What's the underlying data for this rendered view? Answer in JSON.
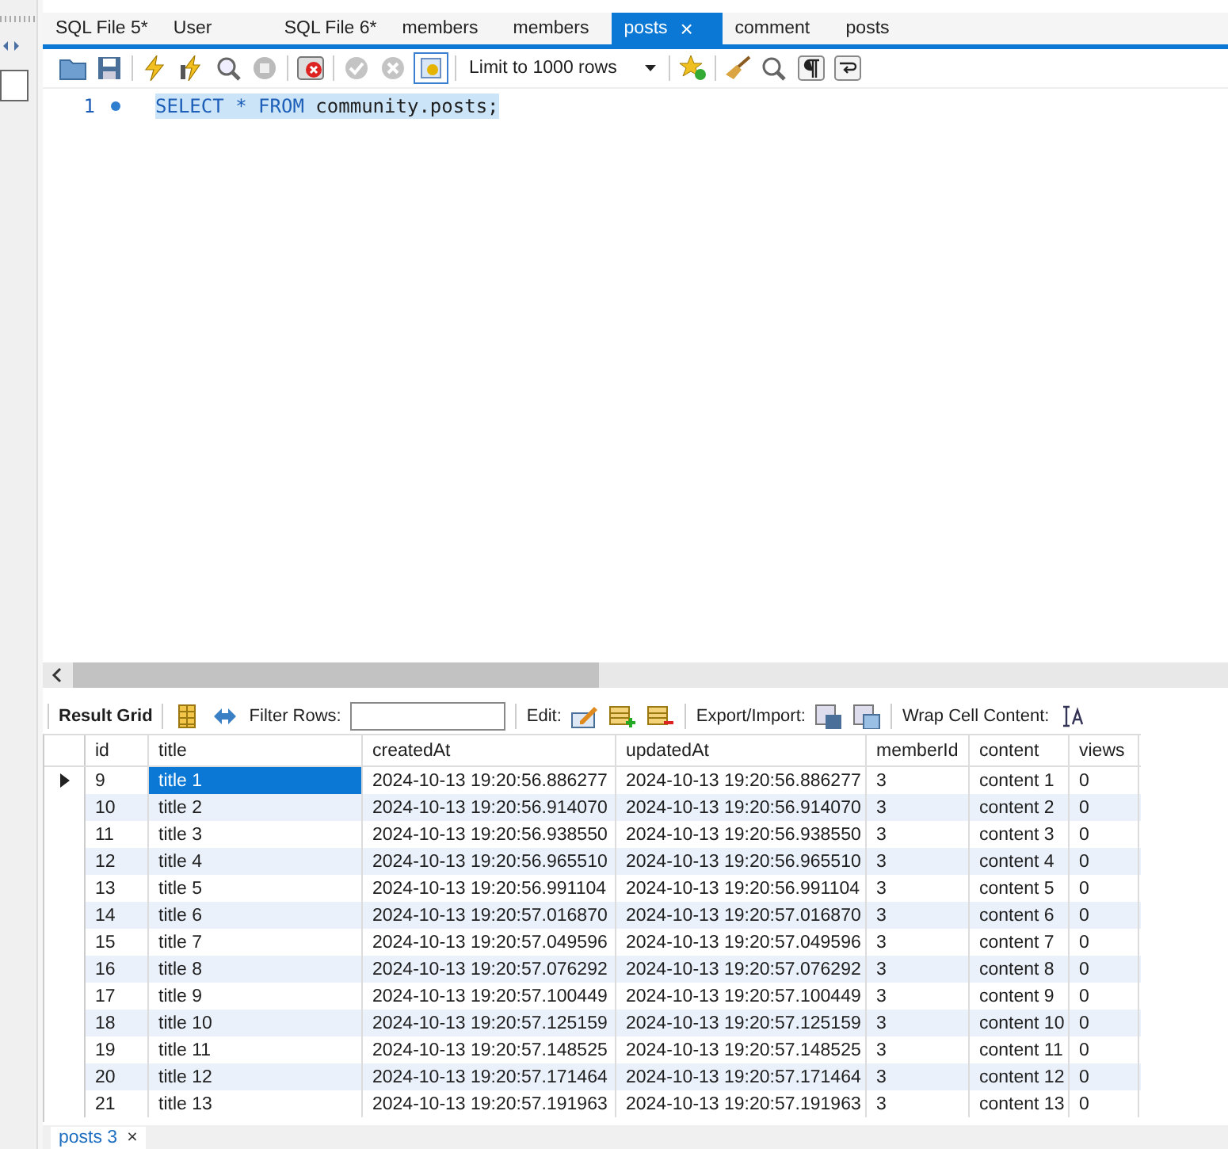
{
  "tabs": [
    {
      "label": "SQL File 5*",
      "selected": false
    },
    {
      "label": "User",
      "selected": false
    },
    {
      "label": "SQL File 6*",
      "selected": false
    },
    {
      "label": "members",
      "selected": false
    },
    {
      "label": "members",
      "selected": false
    },
    {
      "label": "posts",
      "selected": true,
      "close": "×"
    },
    {
      "label": "comment",
      "selected": false
    },
    {
      "label": "posts",
      "selected": false
    }
  ],
  "toolbar": {
    "limit": "Limit to 1000 rows"
  },
  "editor": {
    "lines": [
      {
        "number": "1",
        "tokens": [
          {
            "text": "SELECT",
            "kind": "keyword"
          },
          {
            "text": " * ",
            "kind": "keyword"
          },
          {
            "text": "FROM",
            "kind": "keyword"
          },
          {
            "text": " community.posts;",
            "kind": "plain"
          }
        ]
      }
    ]
  },
  "result_toolbar": {
    "title": "Result Grid",
    "filter_label": "Filter Rows:",
    "edit_label": "Edit:",
    "export_label": "Export/Import:",
    "wrap_label": "Wrap Cell Content:"
  },
  "grid": {
    "columns": [
      "id",
      "title",
      "createdAt",
      "updatedAt",
      "memberId",
      "content",
      "views"
    ],
    "rows": [
      {
        "selected": true,
        "cells": [
          "9",
          "title 1",
          "2024-10-13 19:20:56.886277",
          "2024-10-13 19:20:56.886277",
          "3",
          "content 1",
          "0"
        ]
      },
      {
        "selected": false,
        "cells": [
          "10",
          "title 2",
          "2024-10-13 19:20:56.914070",
          "2024-10-13 19:20:56.914070",
          "3",
          "content 2",
          "0"
        ]
      },
      {
        "selected": false,
        "cells": [
          "11",
          "title 3",
          "2024-10-13 19:20:56.938550",
          "2024-10-13 19:20:56.938550",
          "3",
          "content 3",
          "0"
        ]
      },
      {
        "selected": false,
        "cells": [
          "12",
          "title 4",
          "2024-10-13 19:20:56.965510",
          "2024-10-13 19:20:56.965510",
          "3",
          "content 4",
          "0"
        ]
      },
      {
        "selected": false,
        "cells": [
          "13",
          "title 5",
          "2024-10-13 19:20:56.991104",
          "2024-10-13 19:20:56.991104",
          "3",
          "content 5",
          "0"
        ]
      },
      {
        "selected": false,
        "cells": [
          "14",
          "title 6",
          "2024-10-13 19:20:57.016870",
          "2024-10-13 19:20:57.016870",
          "3",
          "content 6",
          "0"
        ]
      },
      {
        "selected": false,
        "cells": [
          "15",
          "title 7",
          "2024-10-13 19:20:57.049596",
          "2024-10-13 19:20:57.049596",
          "3",
          "content 7",
          "0"
        ]
      },
      {
        "selected": false,
        "cells": [
          "16",
          "title 8",
          "2024-10-13 19:20:57.076292",
          "2024-10-13 19:20:57.076292",
          "3",
          "content 8",
          "0"
        ]
      },
      {
        "selected": false,
        "cells": [
          "17",
          "title 9",
          "2024-10-13 19:20:57.100449",
          "2024-10-13 19:20:57.100449",
          "3",
          "content 9",
          "0"
        ]
      },
      {
        "selected": false,
        "cells": [
          "18",
          "title 10",
          "2024-10-13 19:20:57.125159",
          "2024-10-13 19:20:57.125159",
          "3",
          "content 10",
          "0"
        ]
      },
      {
        "selected": false,
        "cells": [
          "19",
          "title 11",
          "2024-10-13 19:20:57.148525",
          "2024-10-13 19:20:57.148525",
          "3",
          "content 11",
          "0"
        ]
      },
      {
        "selected": false,
        "cells": [
          "20",
          "title 12",
          "2024-10-13 19:20:57.171464",
          "2024-10-13 19:20:57.171464",
          "3",
          "content 12",
          "0"
        ]
      },
      {
        "selected": false,
        "cells": [
          "21",
          "title 13",
          "2024-10-13 19:20:57.191963",
          "2024-10-13 19:20:57.191963",
          "3",
          "content 13",
          "0"
        ]
      }
    ]
  },
  "bottom_tabs": [
    {
      "label": "posts 3",
      "selected": true,
      "close": "×"
    }
  ]
}
